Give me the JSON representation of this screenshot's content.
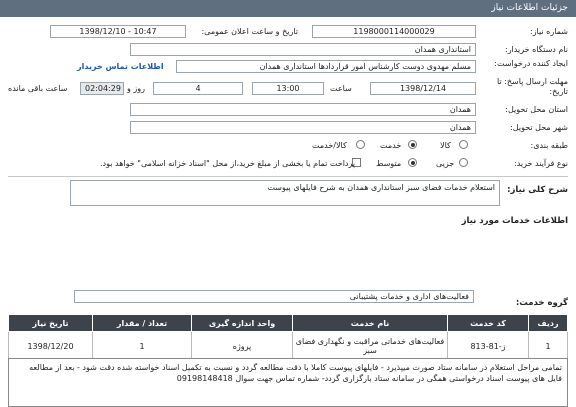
{
  "header": {
    "title": "جزئیات اطلاعات نیاز"
  },
  "fields": {
    "need_number_label": "شماره نیاز:",
    "need_number": "1198000114000029",
    "announce_date_label": "تاریخ و ساعت اعلان عمومی:",
    "announce_date": "1398/12/10 - 10:47",
    "buyer_org_label": "نام دستگاه خریدار:",
    "buyer_org": "استانداری همدان",
    "creator_label": "ایجاد کننده درخواست:",
    "creator": "مسلم مهدوی دوست کارشناس امور قراردادها استانداری همدان",
    "buyer_contact_link": "اطلاعات تماس خریدار",
    "deadline_label": "مهلت ارسال پاسخ: تا تاریخ:",
    "deadline_date": "1398/12/14",
    "time_label": "ساعت",
    "deadline_time": "13:00",
    "days_value": "4",
    "days_label": "روز و",
    "remaining_time": "02:04:29",
    "remaining_label": "ساعت باقی مانده",
    "delivery_province_label": "استان محل تحویل:",
    "delivery_province": "همدان",
    "delivery_city_label": "شهر محل تحویل:",
    "delivery_city": "همدان",
    "category_label": "طبقه بندی:",
    "category_options": [
      "کالا",
      "خدمت",
      "کالا/خدمت"
    ],
    "category_selected": "خدمت",
    "process_label": "نوع فرآیند خرید:",
    "process_options": [
      "جزیی",
      "متوسط"
    ],
    "process_selected": "متوسط",
    "payment_note": "پرداخت تمام یا بخشی از مبلغ خرید،از محل \"اسناد خزانه اسلامی\" خواهد بود."
  },
  "summary": {
    "label": "شرح کلی نیاز:",
    "value": "استعلام خدمات فضای سبز استانداری همدان به شرح فایلهای پیوست"
  },
  "services": {
    "section_title": "اطلاعات خدمات مورد نیاز",
    "group_label": "گروه خدمت:",
    "group_value": "فعالیت‌های اداری و خدمات پشتیبانی"
  },
  "table": {
    "headers": [
      "ردیف",
      "کد خدمت",
      "نام خدمت",
      "واحد اندازه گیری",
      "تعداد / مقدار",
      "تاریخ نیاز"
    ],
    "rows": [
      [
        "1",
        "ز-81-813",
        "فعالیت‌های خدماتی مراقبت و نگهداری فضای سبز",
        "پروژه",
        "1",
        "1398/12/20"
      ]
    ]
  },
  "description": "تمامی مراحل استعلام در سامانه ستاد  صورت میپذیرد - فایلهای پیوست کاملا با دقت مطالعه گردد  و نسبت به تکمیل اسناد خواسته شده دقت شود - بعد از مطالعه فایل های پیوست اسناد درخواستی همگی در سامانه ستاد بارگزاری گردد- شماره تماس جهت سوال 09198148418",
  "colors": {
    "header_bg": "#5f6f80",
    "table_header_bg": "#3c434a",
    "link": "#1f56b5"
  }
}
